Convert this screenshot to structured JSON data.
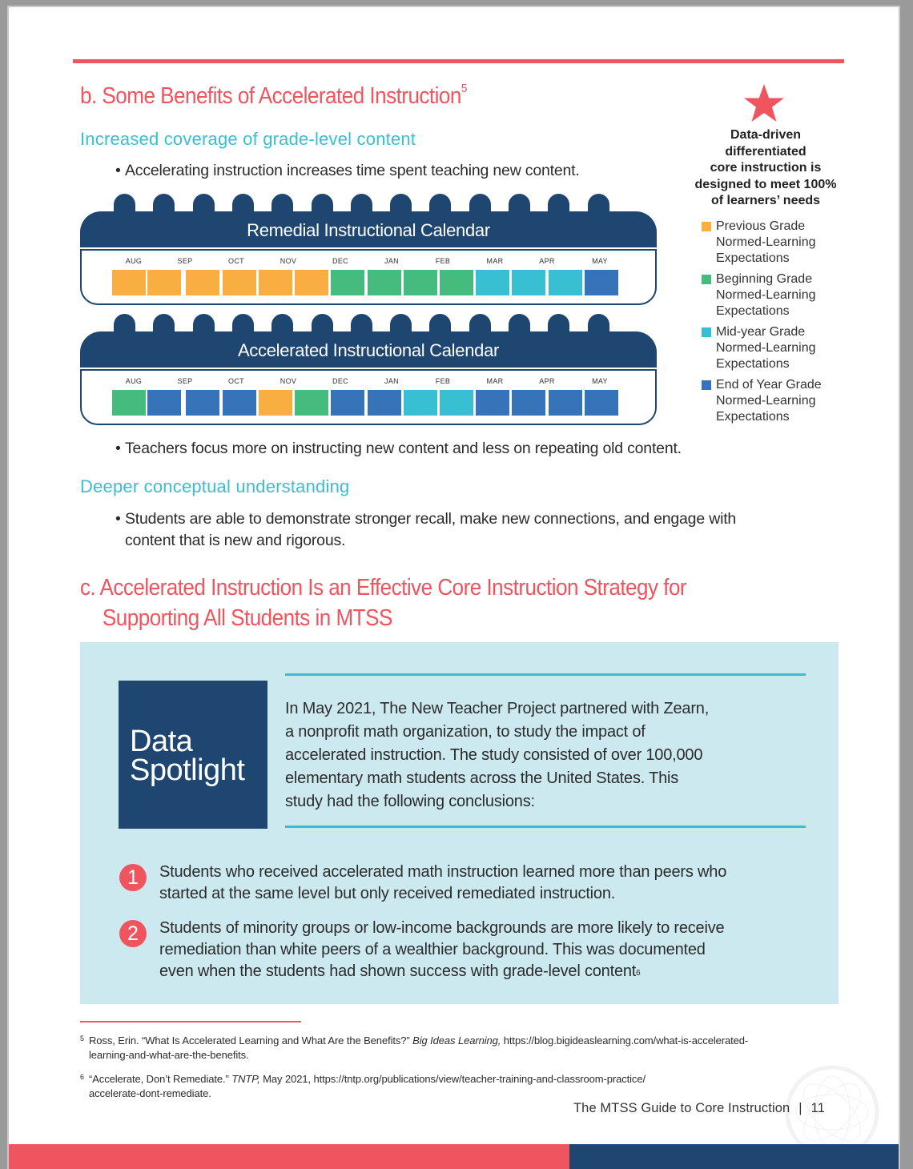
{
  "section_b": {
    "title": "b. Some Benefits of Accelerated Instruction",
    "title_footnote": "5",
    "sub1": {
      "heading": "Increased coverage of grade-level content",
      "bullet1": "Accelerating instruction increases time spent teaching new content.",
      "bullet2": "Teachers focus more on instructing new content and less on repeating old content."
    },
    "sub2": {
      "heading": "Deeper conceptual understanding",
      "bullet1_line1": "Students are able to demonstrate stronger recall, make new connections, and engage with",
      "bullet1_line2": "content that is new and rigorous."
    },
    "bullet_glyph": "•"
  },
  "months": [
    "AUG",
    "SEP",
    "OCT",
    "NOV",
    "DEC",
    "JAN",
    "FEB",
    "MAR",
    "APR",
    "MAY"
  ],
  "calendars": [
    {
      "title": "Remedial Instructional Calendar",
      "cells": [
        "previous",
        "previous",
        "previous",
        "previous",
        "previous",
        "previous",
        "beginning",
        "beginning",
        "beginning",
        "beginning",
        "midyear",
        "midyear",
        "midyear",
        "endofyear"
      ]
    },
    {
      "title": "Accelerated Instructional Calendar",
      "cells": [
        "beginning",
        "endofyear",
        "endofyear",
        "endofyear",
        "previous",
        "beginning",
        "endofyear",
        "endofyear",
        "midyear",
        "midyear",
        "endofyear",
        "endofyear",
        "endofyear",
        "endofyear"
      ]
    }
  ],
  "colors": {
    "previous": "#f9ae41",
    "beginning": "#45bb7e",
    "midyear": "#38bfd1",
    "endofyear": "#3673b9",
    "accent_red": "#ef555f",
    "navy": "#1f4670",
    "teal": "#38bfd1"
  },
  "sidebar": {
    "icon": "star-icon",
    "callout_lines": [
      "Data-driven",
      "differentiated",
      "core instruction is",
      "designed to meet 100%",
      "of learners’ needs"
    ],
    "legend": [
      {
        "key": "previous",
        "lines": [
          "Previous Grade",
          "Normed-Learning",
          "Expectations"
        ]
      },
      {
        "key": "beginning",
        "lines": [
          "Beginning Grade",
          "Normed-Learning",
          "Expectations"
        ]
      },
      {
        "key": "midyear",
        "lines": [
          "Mid-year Grade",
          "Normed-Learning",
          "Expectations"
        ]
      },
      {
        "key": "endofyear",
        "lines": [
          "End of Year Grade",
          "Normed-Learning",
          "Expectations"
        ]
      }
    ]
  },
  "section_c": {
    "title_line1": "c. Accelerated Instruction Is an Effective Core Instruction Strategy for",
    "title_line2": "Supporting All Students in MTSS"
  },
  "spotlight": {
    "tile_line1": "Data",
    "tile_line2": "Spotlight",
    "para_lines": [
      "In May 2021, The New Teacher Project partnered with Zearn,",
      "a nonprofit math organization, to study the impact of",
      "accelerated instruction. The study consisted of over 100,000",
      "elementary math students across the United States. This",
      "study had the following conclusions:"
    ],
    "conclusions": [
      {
        "num": "1",
        "lines": [
          "Students who received accelerated math instruction learned more than peers who",
          "started at the same level but only received remediated instruction."
        ],
        "footnote": ""
      },
      {
        "num": "2",
        "lines": [
          "Students of minority groups or low-income backgrounds are more likely to receive",
          "remediation than white peers of a wealthier background. This was documented",
          "even when the students had shown success with grade-level content"
        ],
        "footnote": "6"
      }
    ]
  },
  "footnotes": [
    {
      "mark": "5",
      "pre": "Ross, Erin. “What Is Accelerated Learning and What Are the Benefits?” ",
      "italic": "Big Ideas Learning,",
      "post_line1": " https://blog.bigideaslearning.com/what-is-accelerated-",
      "line2": "learning-and-what-are-the-benefits."
    },
    {
      "mark": "6",
      "pre": "“Accelerate, Don’t Remediate.” ",
      "italic": "TNTP,",
      "post_line1": " May 2021, https://tntp.org/publications/view/teacher-training-and-classroom-practice/",
      "line2": "accelerate-dont-remediate."
    }
  ],
  "footer": {
    "doc_title": "The MTSS Guide to Core Instruction",
    "separator": "|",
    "page_number": "11"
  }
}
